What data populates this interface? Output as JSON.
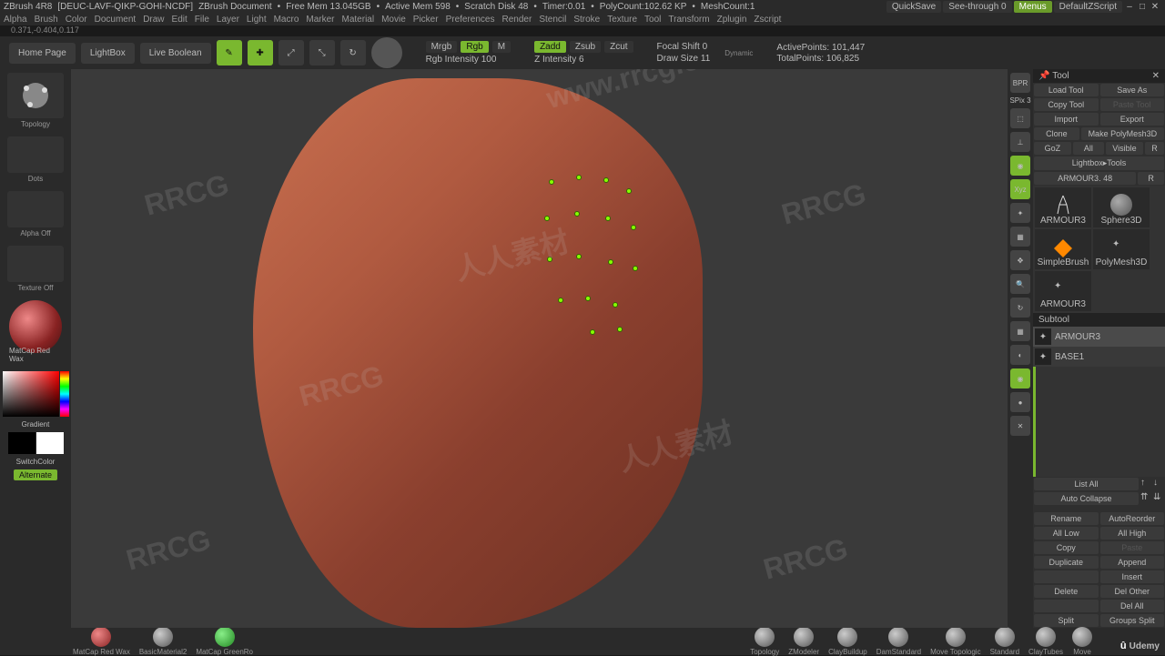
{
  "title": {
    "app": "ZBrush 4R8",
    "doc": "[DEUC-LAVF-QIKP-GOHI-NCDF]",
    "docname": "ZBrush Document",
    "freemem": "Free Mem 13.045GB",
    "activemem": "Active Mem 598",
    "scratch": "Scratch Disk 48",
    "timer": "Timer:0.01",
    "polycount": "PolyCount:102.62 KP",
    "meshcount": "MeshCount:1",
    "quicksave": "QuickSave",
    "seethrough": "See-through 0",
    "menus": "Menus",
    "defscript": "DefaultZScript"
  },
  "menu": [
    "Alpha",
    "Brush",
    "Color",
    "Document",
    "Draw",
    "Edit",
    "File",
    "Layer",
    "Light",
    "Macro",
    "Marker",
    "Material",
    "Movie",
    "Picker",
    "Preferences",
    "Render",
    "Stencil",
    "Stroke",
    "Texture",
    "Tool",
    "Transform",
    "Zplugin",
    "Zscript"
  ],
  "coords": "0.371,-0.404,0.117",
  "topbtns": {
    "home": "Home Page",
    "lightbox": "LightBox",
    "livebool": "Live Boolean"
  },
  "modes": {
    "edit": "Edit",
    "draw": "Draw",
    "move": "Move",
    "scale": "Scale",
    "rotate": "Rotate"
  },
  "mrgb": {
    "mrgb": "Mrgb",
    "rgb": "Rgb",
    "m": "M",
    "rgbint": "Rgb Intensity 100",
    "zadd": "Zadd",
    "zsub": "Zsub",
    "zcut": "Zcut",
    "zint": "Z Intensity 6",
    "focal": "Focal Shift 0",
    "drawsize": "Draw Size 11",
    "dynamic": "Dynamic"
  },
  "stats": {
    "active": "ActivePoints: 101,447",
    "total": "TotalPoints: 106,825"
  },
  "left": {
    "topology": "Topology",
    "dots": "Dots",
    "alpha": "Alpha Off",
    "texture": "Texture Off",
    "material": "MatCap Red Wax",
    "gradient": "Gradient",
    "switch": "SwitchColor",
    "alternate": "Alternate"
  },
  "rside": {
    "spx": "SPix 3",
    "persp": "Persp",
    "floor": "Floor",
    "local": "Local",
    "xyz": "Xyz",
    "frame": "Frame",
    "move": "Move",
    "zoom": "Zoom3D",
    "rot": "Rotate",
    "fill": "Line Fill",
    "transp": "Transp",
    "ghost": "Ghost",
    "solo": "Solo",
    "xpose": "Xpose"
  },
  "toolpanel": {
    "title": "Tool",
    "load": "Load Tool",
    "saveas": "Save As",
    "copy": "Copy Tool",
    "paste": "Paste Tool",
    "import": "Import",
    "export": "Export",
    "clone": "Clone",
    "makepoly": "Make PolyMesh3D",
    "goz": "GoZ",
    "all": "All",
    "visible": "Visible",
    "r": "R",
    "lbtools": "Lightbox▸Tools",
    "armour": "ARMOUR3. 48",
    "subtool": "Subtool",
    "thumbs": [
      "ARMOUR3",
      "Sphere3D",
      "PolyMesh3D",
      "SimpleBrush",
      "ARMOUR3"
    ],
    "subtools": [
      {
        "name": "ARMOUR3"
      },
      {
        "name": "BASE1"
      }
    ],
    "listall": "List All",
    "autocol": "Auto Collapse",
    "rename": "Rename",
    "autoreorder": "AutoReorder",
    "alllow": "All Low",
    "allhigh": "All High",
    "copy2": "Copy",
    "paste2": "Paste",
    "duplicate": "Duplicate",
    "append": "Append",
    "insert": "Insert",
    "delete": "Delete",
    "delother": "Del Other",
    "delall": "Del All",
    "split": "Split",
    "groupsplit": "Groups Split"
  },
  "brushes": [
    "MatCap Red Wax",
    "BasicMaterial2",
    "MatCap GreenRo",
    "",
    "Topology",
    "ZModeler",
    "ClayBuildup",
    "DamStandard",
    "Move Topologic",
    "Standard",
    "ClayTubes",
    "Move"
  ],
  "watermarks": [
    "RRCG",
    "人人素材",
    "www.rrcg.cn"
  ],
  "udemy": "Udemy"
}
